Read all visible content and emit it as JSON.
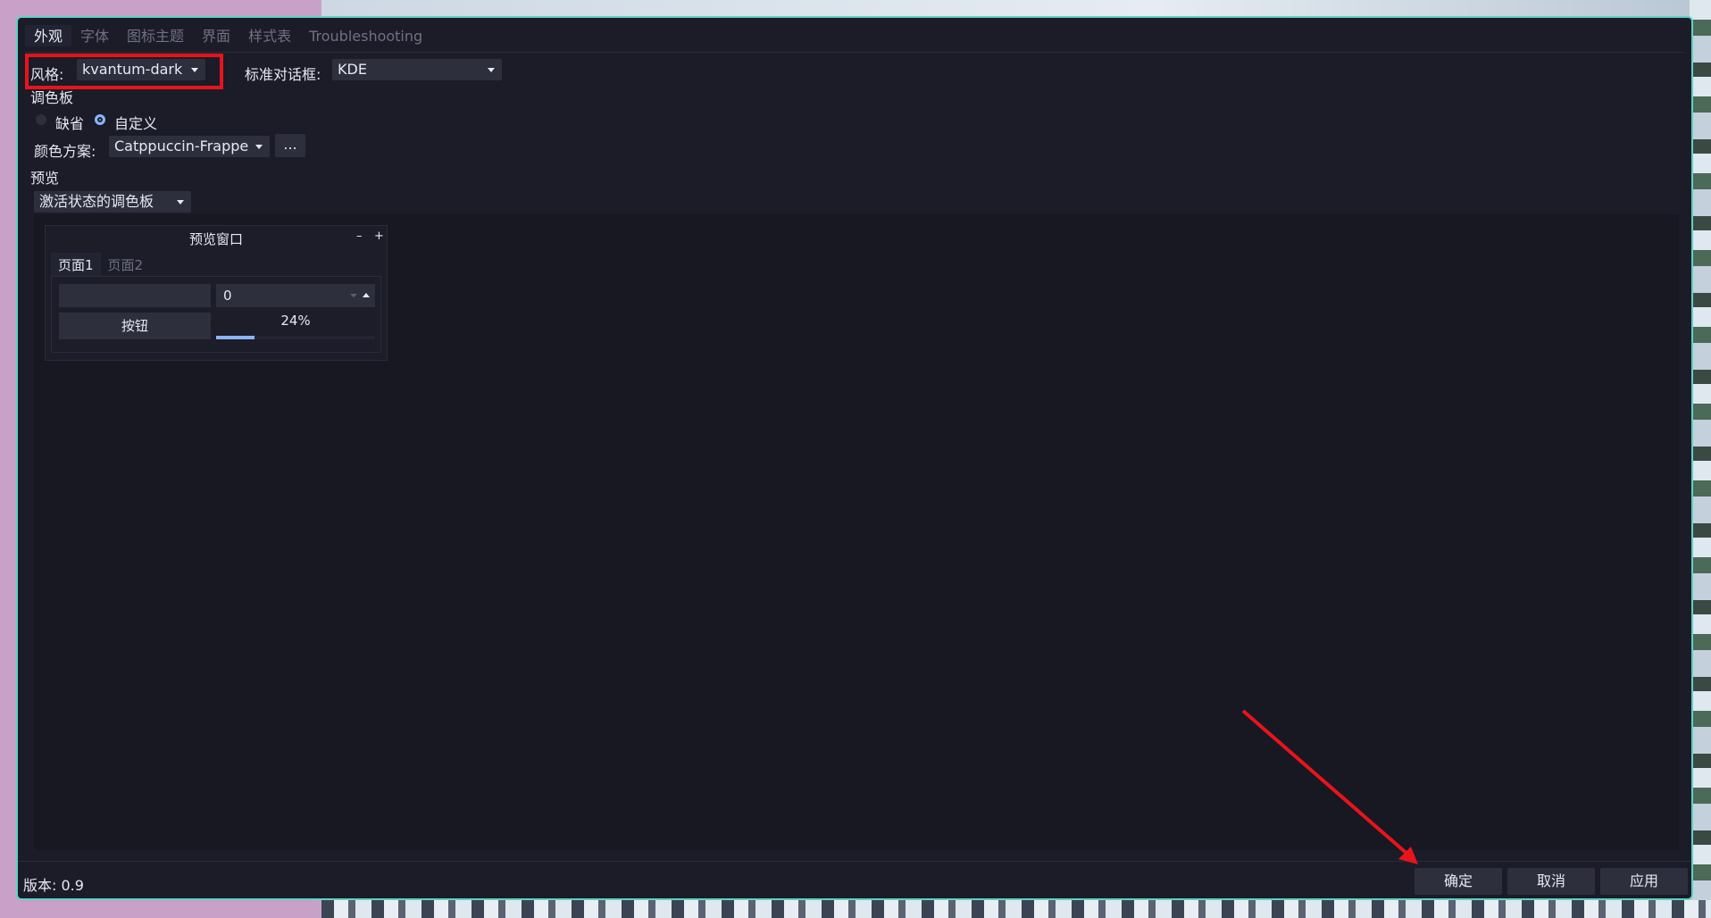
{
  "tabs": [
    {
      "label": "外观",
      "active": true
    },
    {
      "label": "字体",
      "active": false
    },
    {
      "label": "图标主题",
      "active": false
    },
    {
      "label": "界面",
      "active": false
    },
    {
      "label": "样式表",
      "active": false
    },
    {
      "label": "Troubleshooting",
      "active": false
    }
  ],
  "style": {
    "label": "风格:",
    "value": "kvantum-dark"
  },
  "dialog": {
    "label": "标准对话框:",
    "value": "KDE"
  },
  "palette": {
    "heading": "调色板",
    "default_label": "缺省",
    "custom_label": "自定义",
    "selected": "custom",
    "scheme_label": "颜色方案:",
    "scheme_value": "Catppuccin-Frappe",
    "more_button": "..."
  },
  "preview": {
    "heading": "预览",
    "palette_select": "激活状态的调色板",
    "window_title": "预览窗口",
    "min_glyph": "–",
    "max_glyph": "+",
    "tab1": "页面1",
    "tab2": "页面2",
    "spin_value": "0",
    "button_label": "按钮",
    "progress_text": "24%",
    "progress_fraction": 0.24
  },
  "footer": {
    "version": "版本: 0.9",
    "ok": "确定",
    "cancel": "取消",
    "apply": "应用"
  },
  "colors": {
    "accent": "#8ab4f8",
    "highlight_box": "#e8141c",
    "window_border": "#5ed2c6"
  }
}
